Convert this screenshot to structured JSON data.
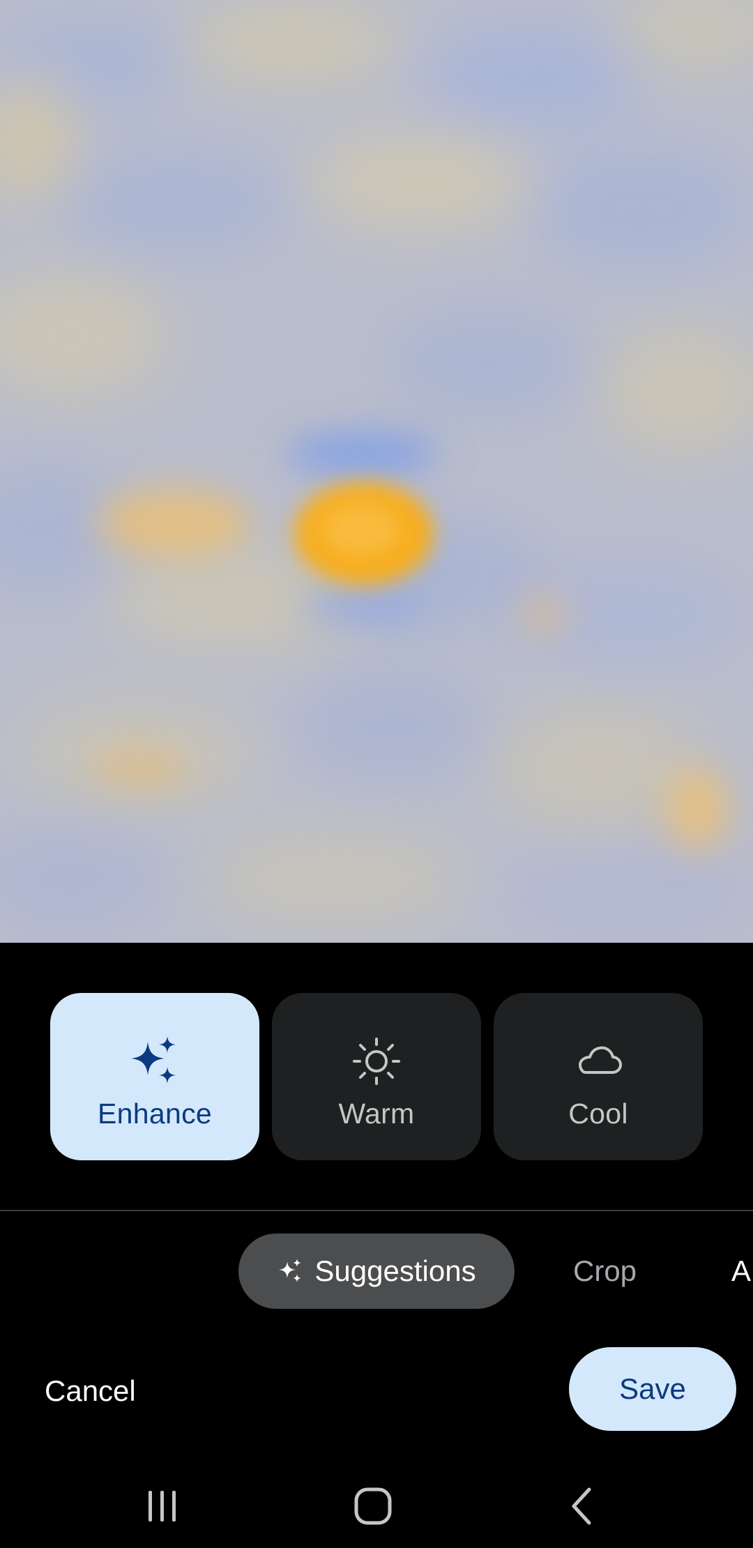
{
  "photo": {
    "icon": "blurred-photo"
  },
  "suggestions": {
    "cards": [
      {
        "label": "Enhance",
        "icon": "sparkle-icon",
        "selected": true
      },
      {
        "label": "Warm",
        "icon": "sun-icon",
        "selected": false
      },
      {
        "label": "Cool",
        "icon": "cloud-icon",
        "selected": false
      }
    ]
  },
  "tabs": {
    "active": {
      "label": "Suggestions",
      "icon": "sparkle-icon"
    },
    "crop": "Crop",
    "next_partial": "A"
  },
  "actions": {
    "cancel": "Cancel",
    "save": "Save"
  },
  "navbar": {
    "recents_icon": "recents-icon",
    "home_icon": "home-icon",
    "back_icon": "back-icon"
  },
  "colors": {
    "accent_bg": "#d3e8fb",
    "accent_text": "#0b3a80",
    "card_bg": "#1f2021",
    "pill_bg": "#4b4d4f"
  }
}
